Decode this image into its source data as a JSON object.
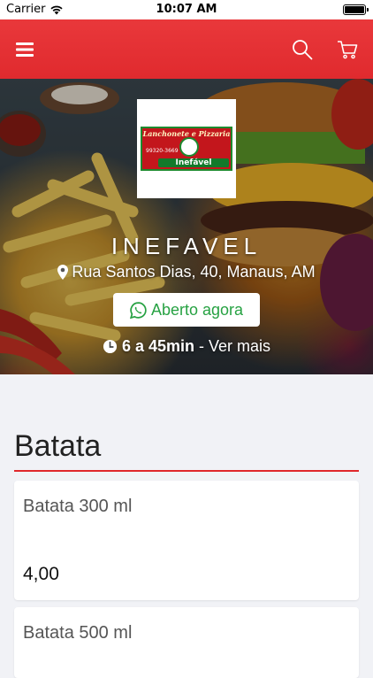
{
  "status_bar": {
    "carrier": "Carrier",
    "time": "10:07 AM"
  },
  "navbar": {
    "menu_icon": "hamburger-icon",
    "search_icon": "search-icon",
    "cart_icon": "cart-icon",
    "color": "#e3302f"
  },
  "store": {
    "logo": {
      "title": "Lanchonete e Pizzaria",
      "name": "Inefável",
      "phone": "99320-3669"
    },
    "name": "INEFAVEL",
    "address": "Rua Santos Dias, 40, Manaus, AM",
    "status_label": "Aberto agora",
    "delivery_time": "6 a 45min",
    "more_label": "- Ver mais"
  },
  "menu": {
    "section": "Batata",
    "items": [
      {
        "name": "Batata 300 ml",
        "price": "4,00"
      },
      {
        "name": "Batata 500 ml",
        "price": ""
      }
    ]
  }
}
